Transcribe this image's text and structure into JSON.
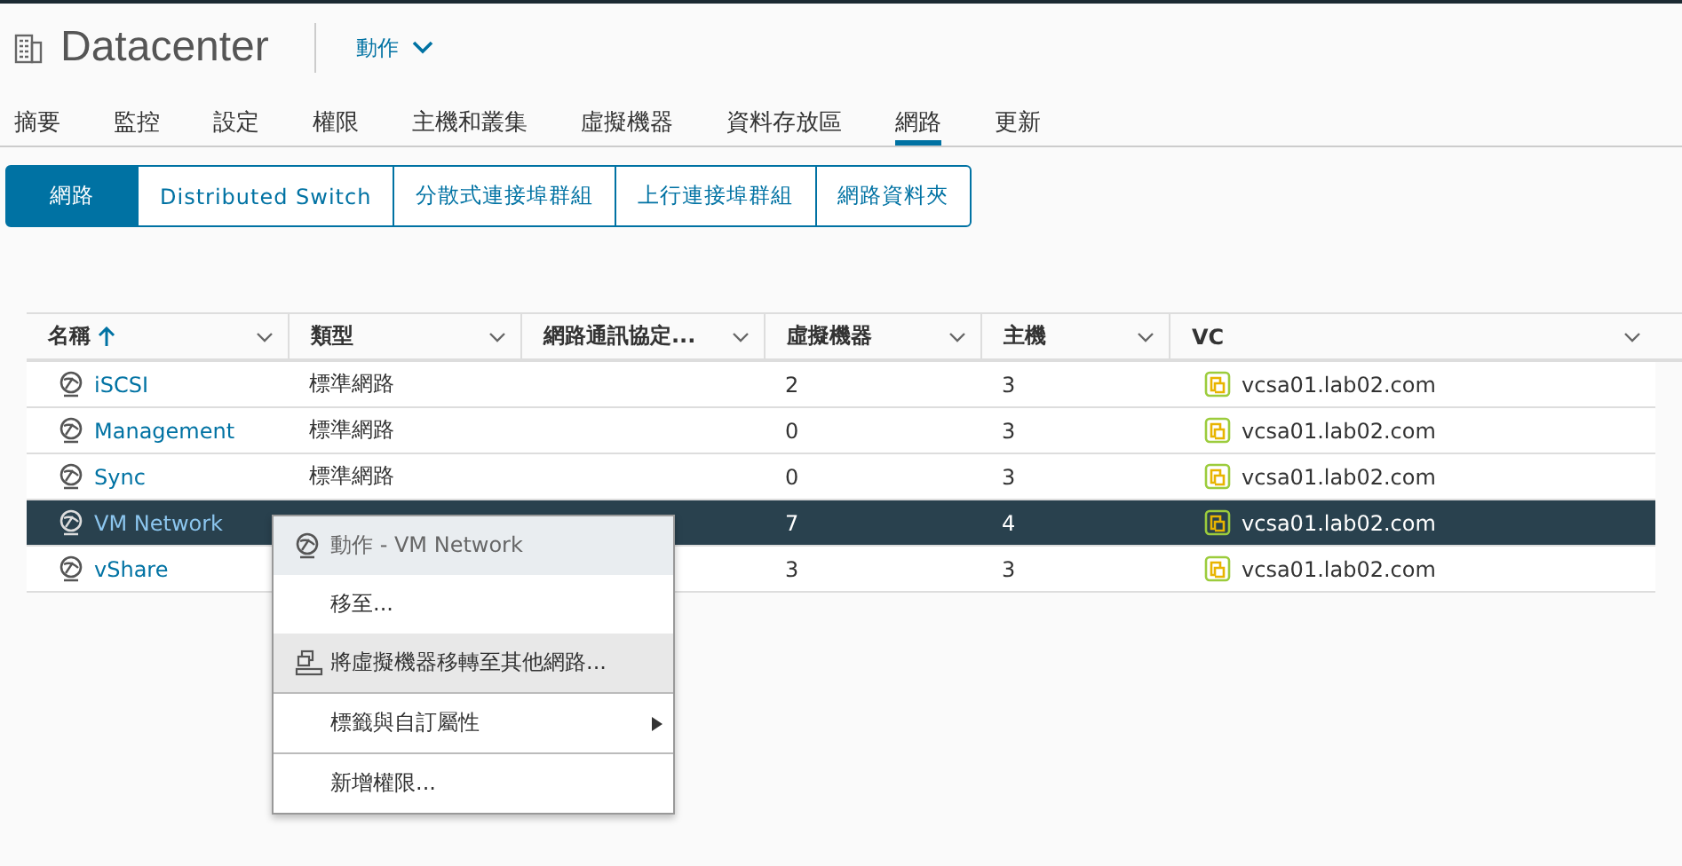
{
  "header": {
    "title": "Datacenter",
    "actions": "動作"
  },
  "tabs": [
    {
      "label": "摘要",
      "selected": false
    },
    {
      "label": "監控",
      "selected": false
    },
    {
      "label": "設定",
      "selected": false
    },
    {
      "label": "權限",
      "selected": false
    },
    {
      "label": "主機和叢集",
      "selected": false
    },
    {
      "label": "虛擬機器",
      "selected": false
    },
    {
      "label": "資料存放區",
      "selected": false
    },
    {
      "label": "網路",
      "selected": true
    },
    {
      "label": "更新",
      "selected": false
    }
  ],
  "subtabs": [
    {
      "label": "網路",
      "selected": true
    },
    {
      "label": "Distributed Switch",
      "selected": false
    },
    {
      "label": "分散式連接埠群組",
      "selected": false
    },
    {
      "label": "上行連接埠群組",
      "selected": false
    },
    {
      "label": "網路資料夾",
      "selected": false
    }
  ],
  "table": {
    "columns": [
      {
        "label": "名稱",
        "sorted": true
      },
      {
        "label": "類型",
        "sorted": false
      },
      {
        "label": "網路通訊協定...",
        "sorted": false
      },
      {
        "label": "虛擬機器",
        "sorted": false
      },
      {
        "label": "主機",
        "sorted": false
      },
      {
        "label": "VC",
        "sorted": false
      }
    ],
    "rows": [
      {
        "name": "iSCSI",
        "type": "標準網路",
        "vms": "2",
        "hosts": "3",
        "vc": "vcsa01.lab02.com",
        "selected": false
      },
      {
        "name": "Management",
        "type": "標準網路",
        "vms": "0",
        "hosts": "3",
        "vc": "vcsa01.lab02.com",
        "selected": false
      },
      {
        "name": "Sync",
        "type": "標準網路",
        "vms": "0",
        "hosts": "3",
        "vc": "vcsa01.lab02.com",
        "selected": false
      },
      {
        "name": "VM Network",
        "vms": "7",
        "hosts": "4",
        "vc": "vcsa01.lab02.com",
        "selected": true
      },
      {
        "name": "vShare",
        "vms": "3",
        "hosts": "3",
        "vc": "vcsa01.lab02.com",
        "selected": false
      }
    ]
  },
  "context_menu": {
    "items": [
      {
        "kind": "title",
        "label": "動作 - VM Network",
        "highlighted": false
      },
      {
        "kind": "plain",
        "label": "移至...",
        "highlighted": false
      },
      {
        "kind": "with-icon",
        "label": "將虛擬機器移轉至其他網路...",
        "highlighted": true
      },
      {
        "kind": "separator"
      },
      {
        "kind": "submenu",
        "label": "標籤與自訂屬性",
        "highlighted": false
      },
      {
        "kind": "separator"
      },
      {
        "kind": "plain",
        "label": "新增權限...",
        "highlighted": false
      }
    ]
  }
}
